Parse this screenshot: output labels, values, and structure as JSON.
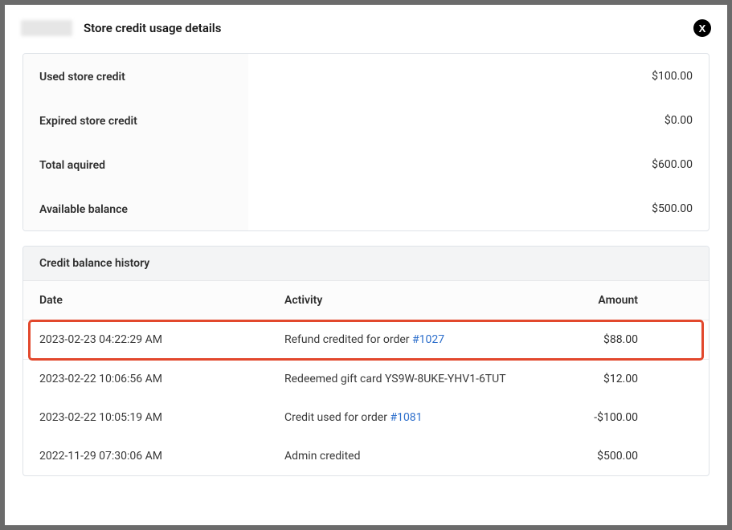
{
  "modal": {
    "title": "Store credit usage details"
  },
  "summary": {
    "used_label": "Used store credit",
    "used_value": "$100.00",
    "expired_label": "Expired store credit",
    "expired_value": "$0.00",
    "acquired_label": "Total aquired",
    "acquired_value": "$600.00",
    "available_label": "Available balance",
    "available_value": "$500.00"
  },
  "history": {
    "title": "Credit balance history",
    "columns": {
      "date": "Date",
      "activity": "Activity",
      "amount": "Amount"
    },
    "rows": [
      {
        "date": "2023-02-23 04:22:29 AM",
        "activity_prefix": "Refund credited for order ",
        "activity_link": "#1027",
        "activity_suffix": "",
        "amount": "$88.00",
        "highlighted": true
      },
      {
        "date": "2023-02-22 10:06:56 AM",
        "activity_prefix": "Redeemed gift card YS9W-8UKE-YHV1-6TUT",
        "activity_link": "",
        "activity_suffix": "",
        "amount": "$12.00",
        "highlighted": false
      },
      {
        "date": "2023-02-22 10:05:19 AM",
        "activity_prefix": "Credit used for order ",
        "activity_link": "#1081",
        "activity_suffix": "",
        "amount": "-$100.00",
        "highlighted": false
      },
      {
        "date": "2022-11-29 07:30:06 AM",
        "activity_prefix": "Admin credited",
        "activity_link": "",
        "activity_suffix": "",
        "amount": "$500.00",
        "highlighted": false
      }
    ]
  }
}
